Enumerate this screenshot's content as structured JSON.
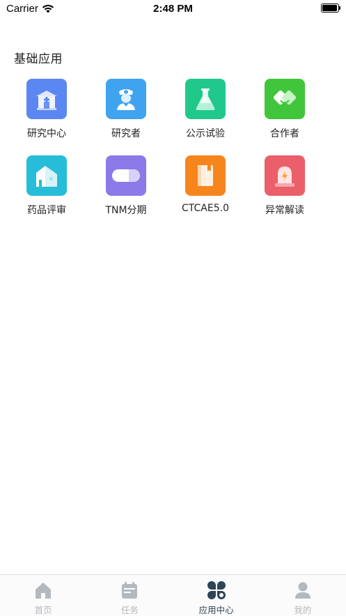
{
  "status_bar": {
    "carrier": "Carrier",
    "time": "2:48 PM"
  },
  "section": {
    "title": "基础应用"
  },
  "apps": [
    {
      "label": "研究中心",
      "icon": "hospital-icon",
      "color": "#5b87f2"
    },
    {
      "label": "研究者",
      "icon": "nurse-icon",
      "color": "#3fa3f0"
    },
    {
      "label": "公示试验",
      "icon": "flask-icon",
      "color": "#20c98a"
    },
    {
      "label": "合作者",
      "icon": "handshake-icon",
      "color": "#41c63b"
    },
    {
      "label": "药品评审",
      "icon": "building-icon",
      "color": "#27bcd8"
    },
    {
      "label": "TNM分期",
      "icon": "pill-icon",
      "color": "#8b7ae8"
    },
    {
      "label": "CTCAE5.0",
      "icon": "book-icon",
      "color": "#f7851e"
    },
    {
      "label": "异常解读",
      "icon": "alarm-lamp-icon",
      "color": "#ea5f69"
    }
  ],
  "tabbar": {
    "active_color": "#2e4457",
    "inactive_color": "#b4b8bf",
    "tabs": [
      {
        "label": "首页",
        "icon": "home-icon",
        "active": false
      },
      {
        "label": "任务",
        "icon": "calendar-icon",
        "active": false
      },
      {
        "label": "应用中心",
        "icon": "apps-icon",
        "active": true
      },
      {
        "label": "我的",
        "icon": "person-icon",
        "active": false
      }
    ]
  }
}
